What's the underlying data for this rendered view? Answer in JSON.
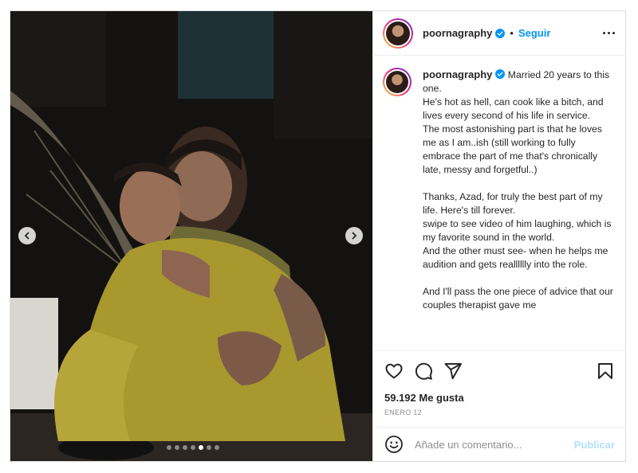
{
  "post": {
    "username": "poornagraphy",
    "follow_label": "Seguir",
    "separator": "•",
    "caption": {
      "username": "poornagraphy",
      "lines": [
        "Married 20 years to this one.",
        "He's hot as hell, can cook like a bitch, and lives every second of his life in service.",
        "The most astonishing part is that he loves me as I am..ish  (still working to fully embrace the part of me that's chronically late, messy and forgetful..)",
        "",
        "Thanks, Azad, for truly the best part of my life. Here's till forever.",
        "swipe to see video of him laughing, which is my favorite sound in the world.",
        "And  the other must see- when he helps me audition and gets realllllly into the role.",
        "",
        "And I'll pass the one piece of advice that our couples therapist gave me"
      ]
    },
    "likes": "59.192 Me gusta",
    "date": "ENERO 12",
    "comment_placeholder": "Añade un comentario...",
    "publish_label": "Publicar",
    "carousel": {
      "total": 7,
      "active_index": 4
    },
    "colors": {
      "accent": "#0095f6",
      "publish_disabled": "#b2dffc",
      "text": "#262626",
      "muted": "#8e8e8e"
    },
    "icons": [
      "verified-icon",
      "more-options-icon",
      "heart-icon",
      "comment-icon",
      "share-icon",
      "bookmark-icon",
      "emoji-icon",
      "chevron-left-icon",
      "chevron-right-icon"
    ]
  }
}
